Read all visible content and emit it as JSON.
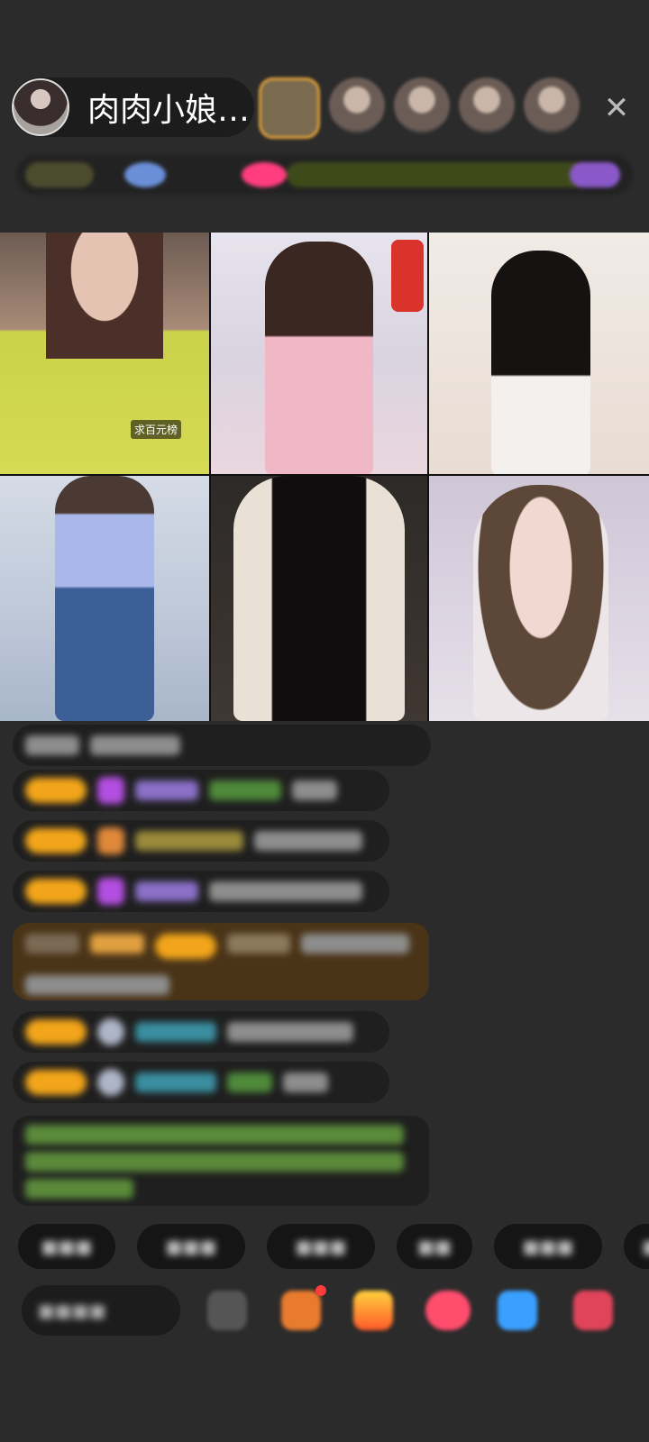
{
  "theme": {
    "background": "#2b2b2b",
    "accent": "#f2a51a",
    "highlight_bg": "#4a3418",
    "chat_green": "#7ebf4a"
  },
  "header": {
    "host_name": "肉肉小娘…",
    "close_icon": "close-icon",
    "close_glyph": "✕"
  },
  "video_grid": {
    "tiles": [
      {
        "tag": "求百元榜"
      },
      {
        "tag": ""
      },
      {
        "tag": ""
      },
      {
        "tag": ""
      },
      {
        "tag": ""
      },
      {
        "tag": ""
      }
    ]
  },
  "composer": {
    "send_icon": "send-icon"
  }
}
